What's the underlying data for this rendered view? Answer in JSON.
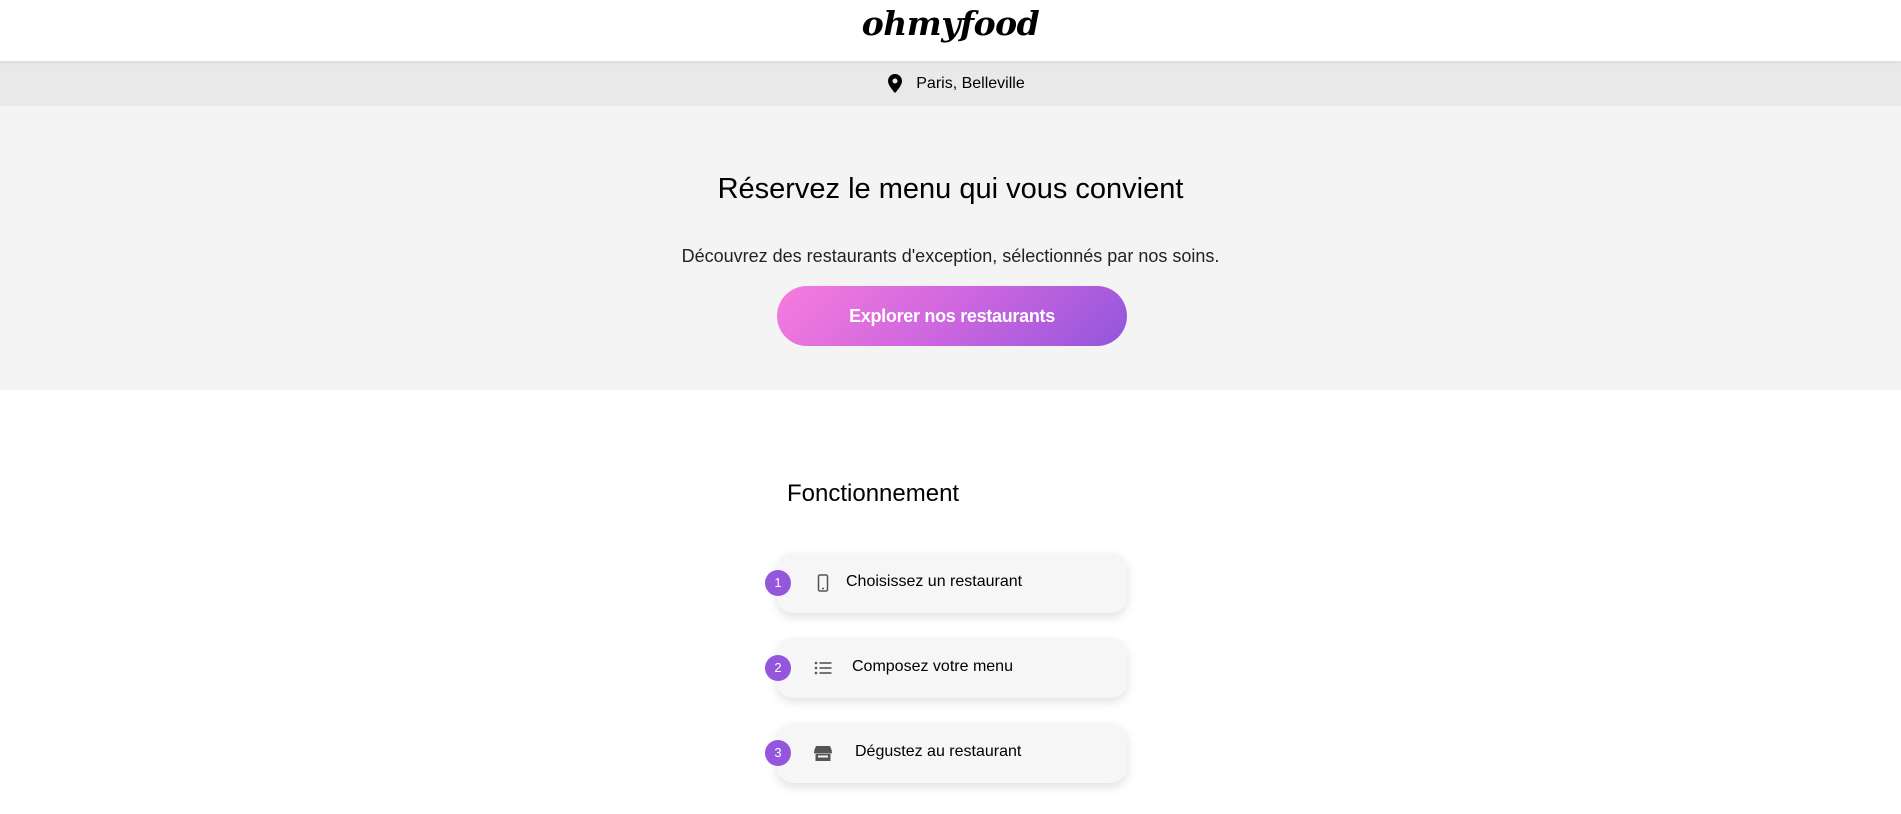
{
  "header": {
    "logo_text": "ohmyfood"
  },
  "location": {
    "icon": "map-pin-icon",
    "text": "Paris, Belleville"
  },
  "hero": {
    "title": "Réservez le menu qui vous convient",
    "subtitle": "Découvrez des restaurants d'exception, sélectionnés par nos soins.",
    "cta_label": "Explorer nos restaurants",
    "cta_gradient": [
      "#f67cdd",
      "#9356dc"
    ]
  },
  "how_it_works": {
    "title": "Fonctionnement",
    "accent_color": "#9356dc",
    "steps": [
      {
        "number": "1",
        "icon": "mobile-phone-icon",
        "label": "Choisissez un restaurant"
      },
      {
        "number": "2",
        "icon": "list-icon",
        "label": "Composez votre menu"
      },
      {
        "number": "3",
        "icon": "store-icon",
        "label": "Dégustez au restaurant"
      }
    ]
  }
}
